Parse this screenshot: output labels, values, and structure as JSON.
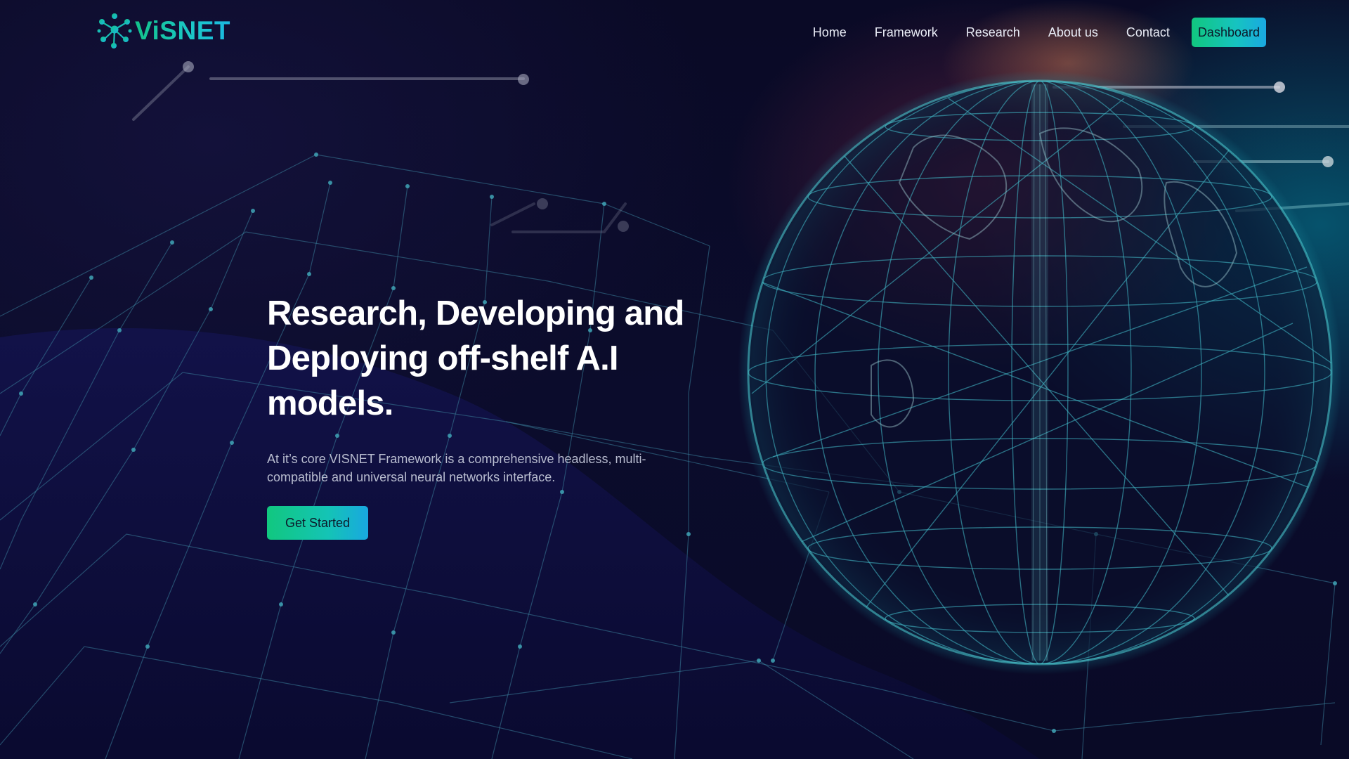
{
  "brand": {
    "name": "ViSNET",
    "logo_icon": "molecule-network-icon",
    "accent_green": "#13c28a",
    "accent_cyan": "#1bb8e0"
  },
  "nav": {
    "items": [
      {
        "label": "Home"
      },
      {
        "label": "Framework"
      },
      {
        "label": "Research"
      },
      {
        "label": "About us"
      },
      {
        "label": "Contact"
      }
    ],
    "dashboard_label": "Dashboard"
  },
  "hero": {
    "title_lines": [
      "Research, Developing and",
      "Deploying off-shelf A.I",
      "models."
    ],
    "subtitle": "At it’s core VISNET Framework is a comprehensive headless, multi-compatible and universal neural networks interface.",
    "cta_label": "Get Started"
  },
  "background": {
    "illustration": "wireframe-globe-and-network-grid",
    "base_color": "#0a0a26",
    "glow_colors": [
      "#f0965a",
      "#782846",
      "#00aabe"
    ]
  }
}
